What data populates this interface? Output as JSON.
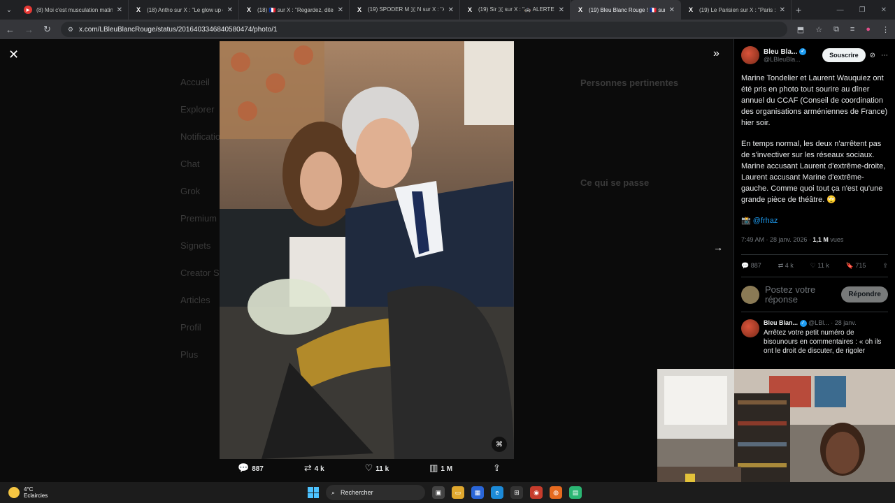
{
  "browser": {
    "tabs": [
      {
        "title": "(8) Moi c'est musculation matin",
        "favicon": "youtube-icon"
      },
      {
        "title": "(18) Antho sur X : \"Le glow up c",
        "favicon": "x-icon"
      },
      {
        "title": "(18) 🇫🇷 sur X : \"Regardez, dites",
        "favicon": "x-icon"
      },
      {
        "title": "(19) SPODER M 🇽 N sur X : \"Al",
        "favicon": "x-icon"
      },
      {
        "title": "(19) Sir 🇽 sur X : \"🚓 ALERTE",
        "favicon": "x-icon"
      },
      {
        "title": "(19) Bleu Blanc Rouge ! 🇫🇷 sur X",
        "favicon": "x-icon"
      },
      {
        "title": "(19) Le Parisien sur X : \"Paris : a",
        "favicon": "x-icon"
      }
    ],
    "active_tab": 5,
    "url": "x.com/LBleuBlancRouge/status/2016403346840580474/photo/1"
  },
  "viewer": {
    "ghost_nav": [
      "Accueil",
      "Explorer",
      "Notifications",
      "Chat",
      "Grok",
      "Premium",
      "Signets",
      "Creator Studio",
      "Articles",
      "Profil",
      "Plus"
    ],
    "ghost_right": [
      "Personnes pertinentes",
      "Ce qui se passe"
    ],
    "actions": {
      "replies": "887",
      "reposts": "4 k",
      "likes": "11 k",
      "views": "1 M"
    }
  },
  "post": {
    "author_name": "Bleu Bla...",
    "author_handle": "@LBleuBla...",
    "subscribe_label": "Souscrire",
    "paragraph1": "Marine Tondelier et Laurent Wauquiez ont été pris en photo tout sourire au dîner annuel du CCAF (Conseil de coordination des organisations arméniennes de France) hier soir.",
    "paragraph2": "En temps normal, les deux n'arrêtent pas de s'invectiver sur les réseaux sociaux. Marine accusant Laurent d'extrême-droite, Laurent accusant Marine d'extrême-gauche. Comme quoi tout ça n'est qu'une grande pièce de théâtre. 🙄",
    "credit_emoji": "📸",
    "credit_handle": "@frhaz",
    "time": "7:49 AM · 28 janv. 2026 · ",
    "views": "1,1 M",
    "views_label": " vues",
    "stats": {
      "replies": "887",
      "reposts": "4 k",
      "likes": "11 k",
      "bookmarks": "715"
    },
    "reply_placeholder": "Postez votre réponse",
    "reply_button": "Répondre"
  },
  "reply": {
    "author_name": "Bleu Blan...",
    "author_handle": "@LBl...",
    "date": "· 28 janv.",
    "text": "Arrêtez votre petit numéro de bisounours en commentaires : « oh ils ont le droit de discuter, de rigoler"
  },
  "taskbar": {
    "temperature": "4°C",
    "weather": "Eclaircies",
    "search_label": "Rechercher"
  }
}
